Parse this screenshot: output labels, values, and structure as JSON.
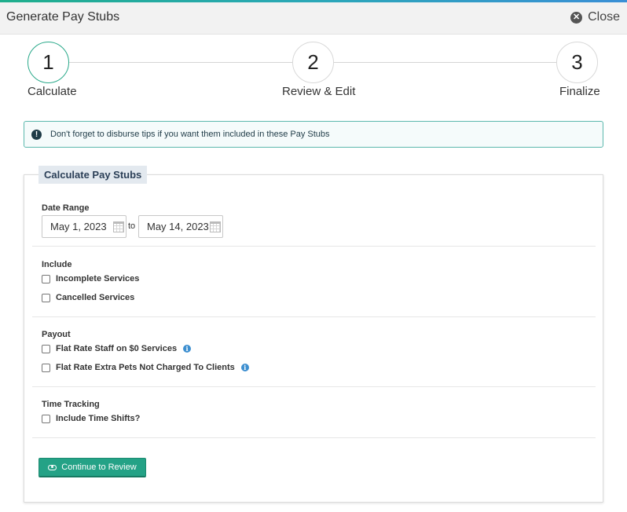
{
  "window": {
    "title": "Generate Pay Stubs",
    "close_label": "Close"
  },
  "steps": [
    {
      "number": "1",
      "label": "Calculate",
      "active": true
    },
    {
      "number": "2",
      "label": "Review & Edit",
      "active": false
    },
    {
      "number": "3",
      "label": "Finalize",
      "active": false
    }
  ],
  "alert": {
    "icon": "exclamation-icon",
    "text": "Don't forget to disburse tips if you want them included in these Pay Stubs"
  },
  "form": {
    "legend": "Calculate Pay Stubs",
    "date_range": {
      "label": "Date Range",
      "start": "May 1, 2023",
      "separator": "to",
      "end": "May 14, 2023"
    },
    "include": {
      "label": "Include",
      "options": [
        {
          "label": "Incomplete Services",
          "checked": false
        },
        {
          "label": "Cancelled Services",
          "checked": false
        }
      ]
    },
    "payout": {
      "label": "Payout",
      "options": [
        {
          "label": "Flat Rate Staff on $0 Services",
          "checked": false,
          "info": true
        },
        {
          "label": "Flat Rate Extra Pets Not Charged To Clients",
          "checked": false,
          "info": true
        }
      ]
    },
    "time_tracking": {
      "label": "Time Tracking",
      "options": [
        {
          "label": "Include Time Shifts?",
          "checked": false
        }
      ]
    },
    "submit_label": "Continue to Review"
  },
  "colors": {
    "accent": "#24a286",
    "step_active_border": "#2aa98a",
    "alert_border": "#5cb8ad",
    "legend_bg": "#e3e9ef",
    "info_icon": "#3d8fd0"
  }
}
